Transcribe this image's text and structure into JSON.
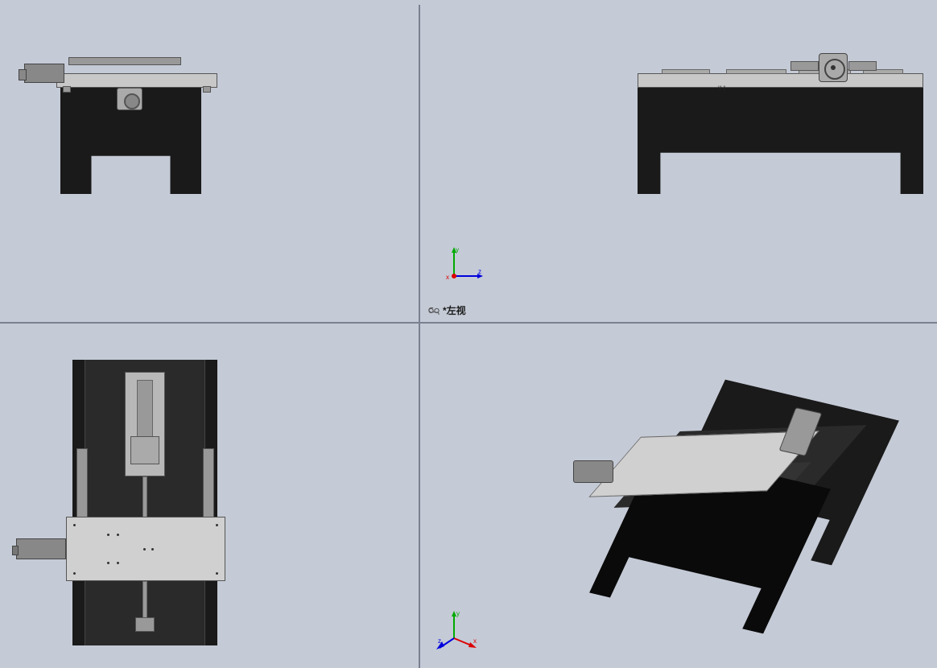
{
  "toolbar": {
    "icons": [
      "cursor-icon",
      "pan-icon",
      "rotate-icon",
      "zoom-icon",
      "fit-icon",
      "display-icon",
      "section-icon",
      "scene-icon"
    ]
  },
  "viewports": {
    "top_left": {
      "label": ""
    },
    "top_right": {
      "label": "*左视",
      "axis": {
        "x": "x",
        "y": "y",
        "z": "z"
      }
    },
    "bottom_left": {
      "label": ""
    },
    "bottom_right": {
      "label": "",
      "axis": {
        "x": "x",
        "y": "y",
        "z": "z"
      }
    }
  }
}
